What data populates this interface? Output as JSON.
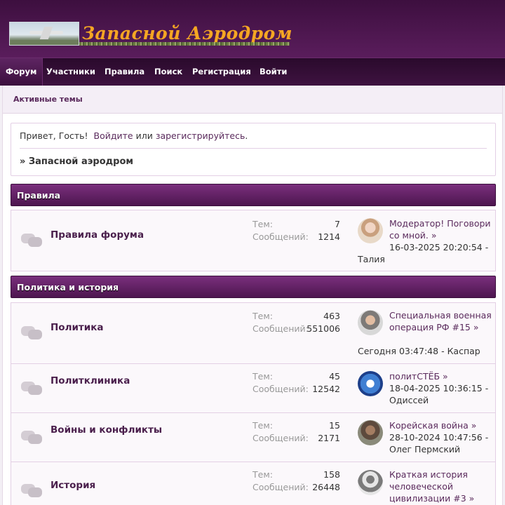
{
  "header": {
    "site_title": "Запасной Аэродром"
  },
  "nav": [
    {
      "label": "Форум"
    },
    {
      "label": "Участники"
    },
    {
      "label": "Правила"
    },
    {
      "label": "Поиск"
    },
    {
      "label": "Регистрация"
    },
    {
      "label": "Войти"
    }
  ],
  "subbar": {
    "active_topics": "Активные темы"
  },
  "greeting": {
    "hello": "Привет, Гость!",
    "login": "Войдите",
    "or": "или",
    "register": "зарегистрируйтесь",
    "dot": ".",
    "breadcrumb": "» Запасной аэродром"
  },
  "categories": [
    {
      "title": "Правила",
      "boards": [
        {
          "title": "Правила форума",
          "topics_label": "Тем:",
          "topics": "7",
          "posts_label": "Сообщений:",
          "posts": "1214",
          "last_topic": "Модератор! Поговори со мной.",
          "last_date": "16-03-2025 20:20:54",
          "last_user": "Талия"
        }
      ]
    },
    {
      "title": "Политика и история",
      "boards": [
        {
          "title": "Политика",
          "topics_label": "Тем:",
          "topics": "463",
          "posts_label": "Сообщений:",
          "posts": "551006",
          "last_topic": "Специальная военная операция РФ #15",
          "last_date": "Сегодня 03:47:48",
          "last_user": "Каспар"
        },
        {
          "title": "Политклиника",
          "topics_label": "Тем:",
          "topics": "45",
          "posts_label": "Сообщений:",
          "posts": "12542",
          "last_topic": "политСТЁБ",
          "last_date": "18-04-2025 10:36:15",
          "last_user": "Одиссей"
        },
        {
          "title": "Войны и конфликты",
          "topics_label": "Тем:",
          "topics": "15",
          "posts_label": "Сообщений:",
          "posts": "2171",
          "last_topic": "Корейская война",
          "last_date": "28-10-2024 10:47:56",
          "last_user": "Олег Пермский"
        },
        {
          "title": "История",
          "topics_label": "Тем:",
          "topics": "158",
          "posts_label": "Сообщений:",
          "posts": "26448",
          "last_topic": "Краткая история человеческой цивилизации #3",
          "last_date": "",
          "last_user": ""
        }
      ]
    }
  ],
  "icons": {
    "board": "chat-bubbles-icon",
    "arrow": "double-arrow-right-icon"
  },
  "colors": {
    "header_bg": "#4a1650",
    "logo_text": "#f5a623",
    "category_bar": "#6a2470",
    "link": "#5a2a5c"
  }
}
